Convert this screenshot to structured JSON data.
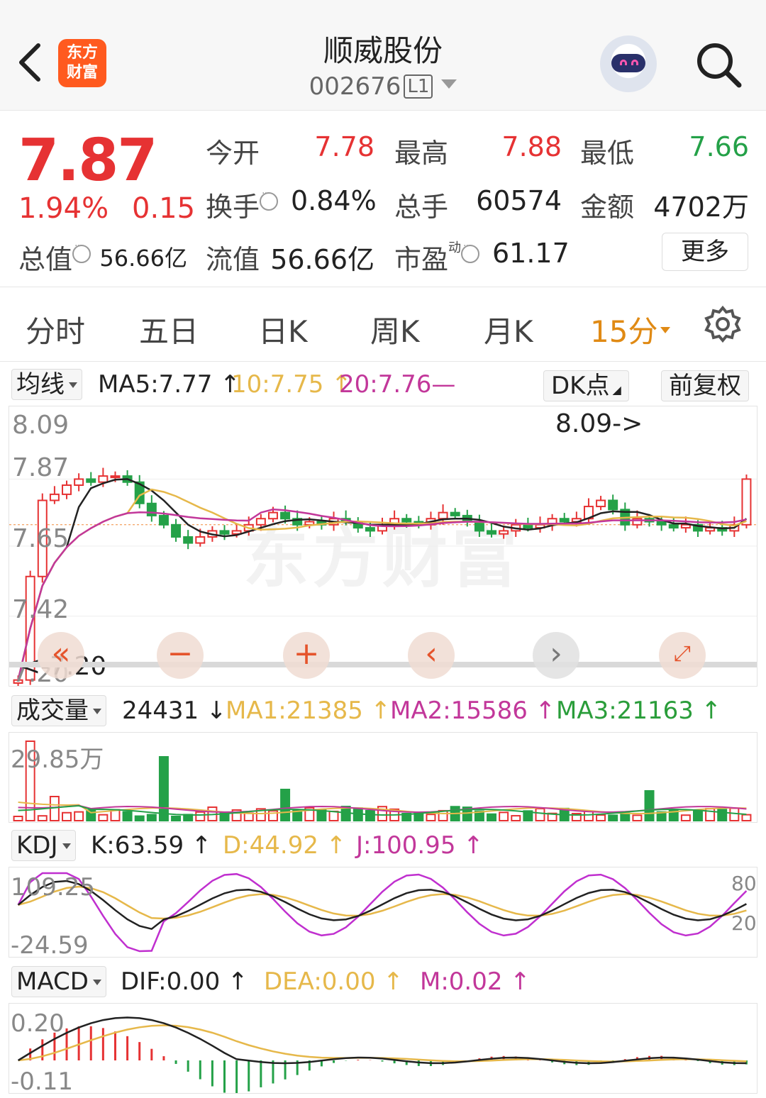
{
  "header": {
    "logo_line1": "东方",
    "logo_line2": "财富",
    "stock_name": "顺威股份",
    "stock_code": "002676",
    "level_tag": "L1"
  },
  "quote": {
    "price": "7.87",
    "change_pct": "1.94%",
    "change_amt": "0.15",
    "open_label": "今开",
    "open_value": "7.78",
    "high_label": "最高",
    "high_value": "7.88",
    "low_label": "最低",
    "low_value": "7.66",
    "turnover_label": "换手",
    "turnover_value": "0.84%",
    "volume_label": "总手",
    "volume_value": "60574",
    "amount_label": "金额",
    "amount_value": "4702万",
    "mktcap_label": "总值",
    "mktcap_value": "56.66亿",
    "float_label": "流值",
    "float_value": "56.66亿",
    "pe_label": "市盈",
    "pe_super": "动",
    "pe_value": "61.17",
    "more_label": "更多"
  },
  "tabs": [
    "分时",
    "五日",
    "日K",
    "周K",
    "月K",
    "15分"
  ],
  "ma_row": {
    "selector": "均线",
    "ma5": "MA5:7.77 ↑",
    "ma10": "10:7.75 ↑",
    "ma20": "20:7.76—",
    "dk_label": "DK点",
    "adjust_label": "前复权"
  },
  "kline": {
    "y_labels": [
      "8.09",
      "7.87",
      "7.65",
      "7.42",
      "7.20"
    ],
    "max_marker": "8.09->",
    "min_marker": "<-7.20",
    "watermark": "东方财富"
  },
  "volume_row": {
    "selector": "成交量",
    "value": "24431 ↓",
    "ma1": "MA1:21385 ↑",
    "ma2": "MA2:15586 ↑",
    "ma3": "MA3:21163 ↑",
    "y_label": "29.85万"
  },
  "kdj_row": {
    "selector": "KDJ",
    "k": "K:63.59 ↑",
    "d": "D:44.92 ↑",
    "j": "J:100.95 ↑",
    "y_top": "109.25",
    "y_bottom": "-24.59",
    "right_top": "80",
    "right_bottom": "20"
  },
  "macd_row": {
    "selector": "MACD",
    "dif": "DIF:0.00 ↑",
    "dea": "DEA:0.00 ↑",
    "m": "M:0.02 ↑",
    "y_top": "0.20",
    "y_bottom": "-0.11"
  },
  "colors": {
    "up": "#e63233",
    "down": "#24a148",
    "accent": "#e08a14",
    "ma5": "#222222",
    "ma10": "#e6b84a",
    "ma20": "#c2379a"
  },
  "chart_data": {
    "type": "candlestick",
    "interval": "15分",
    "ylim": [
      7.2,
      8.09
    ],
    "reference_price": 7.72,
    "series": [
      {
        "name": "MA5",
        "color": "#222222"
      },
      {
        "name": "MA10",
        "color": "#e6b84a"
      },
      {
        "name": "MA20",
        "color": "#c2379a"
      }
    ],
    "close_prices": [
      7.21,
      7.55,
      7.8,
      7.82,
      7.85,
      7.87,
      7.86,
      7.88,
      7.88,
      7.86,
      7.79,
      7.75,
      7.72,
      7.68,
      7.66,
      7.68,
      7.7,
      7.69,
      7.7,
      7.72,
      7.74,
      7.76,
      7.74,
      7.72,
      7.73,
      7.72,
      7.74,
      7.73,
      7.71,
      7.7,
      7.72,
      7.74,
      7.73,
      7.72,
      7.74,
      7.76,
      7.75,
      7.73,
      7.7,
      7.69,
      7.7,
      7.72,
      7.71,
      7.72,
      7.74,
      7.73,
      7.74,
      7.78,
      7.8,
      7.77,
      7.72,
      7.74,
      7.73,
      7.72,
      7.71,
      7.72,
      7.7,
      7.71,
      7.7,
      7.72,
      7.87
    ],
    "annotations": [
      "8.09->",
      "<-7.20"
    ]
  }
}
